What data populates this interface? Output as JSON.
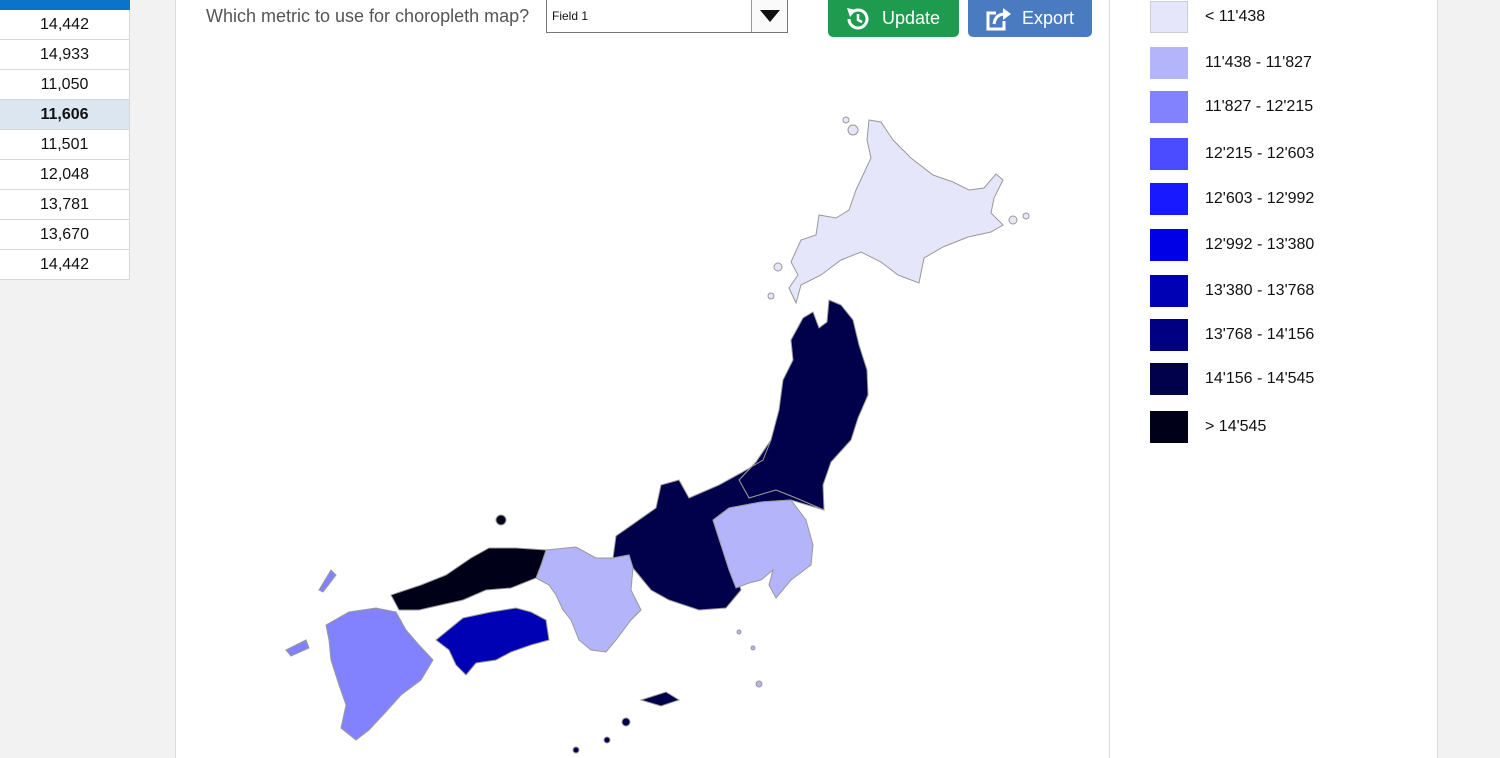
{
  "table": {
    "rows": [
      {
        "value": "14,442",
        "selected": false
      },
      {
        "value": "14,933",
        "selected": false
      },
      {
        "value": "11,050",
        "selected": false
      },
      {
        "value": "11,606",
        "selected": true
      },
      {
        "value": "11,501",
        "selected": false
      },
      {
        "value": "12,048",
        "selected": false
      },
      {
        "value": "13,781",
        "selected": false
      },
      {
        "value": "13,670",
        "selected": false
      },
      {
        "value": "14,442",
        "selected": false
      }
    ]
  },
  "toolbar": {
    "metric_label": "Which metric to use for choropleth map?",
    "metric_value": "Field 1",
    "update_label": "Update",
    "export_label": "Export"
  },
  "legend": {
    "items": [
      {
        "label": "< 11'438",
        "color": "#e6e6fa"
      },
      {
        "label": "11'438 - 11'827",
        "color": "#b4b4fa"
      },
      {
        "label": "11'827 - 12'215",
        "color": "#8282ff"
      },
      {
        "label": "12'215 - 12'603",
        "color": "#4b4bff"
      },
      {
        "label": "12'603 - 12'992",
        "color": "#1919ff"
      },
      {
        "label": "12'992 - 13'380",
        "color": "#0000e6"
      },
      {
        "label": "13'380 - 13'768",
        "color": "#0000b4"
      },
      {
        "label": "13'768 - 14'156",
        "color": "#000082"
      },
      {
        "label": "14'156 - 14'545",
        "color": "#00004b"
      },
      {
        "label": "> 14'545",
        "color": "#000019"
      }
    ]
  },
  "map": {
    "regions": [
      {
        "name": "hokkaido",
        "color": "#e6e6fa"
      },
      {
        "name": "tohoku",
        "color": "#00004b"
      },
      {
        "name": "chubu",
        "color": "#00004b"
      },
      {
        "name": "kanto",
        "color": "#b4b4fa"
      },
      {
        "name": "kinki",
        "color": "#b4b4fa"
      },
      {
        "name": "chugoku",
        "color": "#000019"
      },
      {
        "name": "shikoku",
        "color": "#0000b4"
      },
      {
        "name": "kyushu",
        "color": "#8282ff"
      }
    ]
  }
}
